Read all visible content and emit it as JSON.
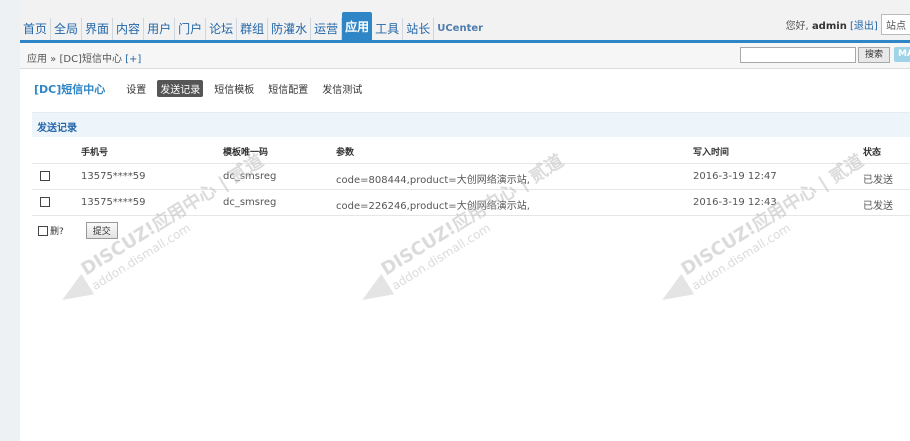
{
  "nav": {
    "items": [
      "首页",
      "全局",
      "界面",
      "内容",
      "用户",
      "门户",
      "论坛",
      "群组",
      "防灌水",
      "运营",
      "应用",
      "工具",
      "站长",
      "UCenter"
    ],
    "active_index": 10
  },
  "user": {
    "greeting": "您好,",
    "name": "admin",
    "logout": "[退出]",
    "site": "站点"
  },
  "breadcrumb": {
    "text": "应用 » [DC]短信中心",
    "plus": "[+]"
  },
  "search": {
    "button": "搜索",
    "map_button": "MA"
  },
  "plugin": {
    "title": "[DC]短信中心",
    "tabs": [
      "设置",
      "发送记录",
      "短信模板",
      "短信配置",
      "发信测试"
    ],
    "active_tab": 1
  },
  "section_title": "发送记录",
  "table": {
    "columns": [
      "手机号",
      "模板唯一码",
      "参数",
      "写入时间",
      "状态"
    ],
    "rows": [
      {
        "phone": "13575****59",
        "template": "dc_smsreg",
        "params": "code=808444,product=大创网络演示站,",
        "time": "2016-3-19 12:47",
        "status": "已发送"
      },
      {
        "phone": "13575****59",
        "template": "dc_smsreg",
        "params": "code=226246,product=大创网络演示站,",
        "time": "2016-3-19 12:43",
        "status": "已发送"
      }
    ]
  },
  "footer": {
    "delete_label": "删?",
    "submit_label": "提交"
  },
  "watermark": {
    "brand": "DISCUZ!应用中心 | 贰道",
    "url": "addon.dismall.com"
  },
  "colors": {
    "accent": "#2f86c6",
    "link": "#2366a8",
    "active_tab_bg": "#555555"
  }
}
